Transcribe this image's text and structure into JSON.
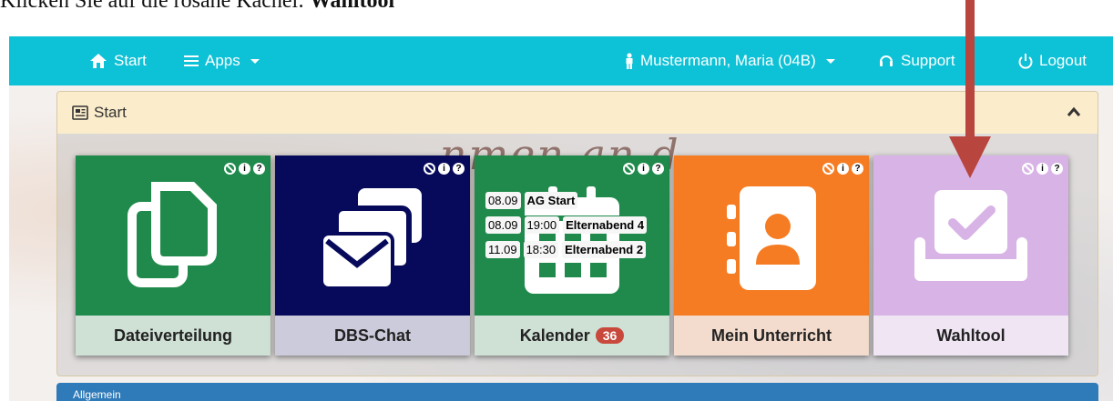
{
  "instruction": {
    "prefix": "Klicken Sie auf die rosane Kachel: ",
    "target": "Wahltool"
  },
  "navbar": {
    "background": "#0dc1d6",
    "start_label": "Start",
    "apps_label": "Apps",
    "user_label": "Mustermann, Maria (04B)",
    "support_label": "Support",
    "logout_label": "Logout"
  },
  "panel": {
    "title": "Start",
    "header_background": "#fbeccb",
    "background_text": "...nmen an d..."
  },
  "tiles": [
    {
      "label": "Dateiverteilung",
      "color": "#1f8a4c",
      "label_bg": "#cfe0d5",
      "icon": "files-icon"
    },
    {
      "label": "DBS-Chat",
      "color": "#070a5a",
      "label_bg": "#cccbdb",
      "icon": "messages-icon"
    },
    {
      "label": "Kalender",
      "color": "#1f8a4c",
      "label_bg": "#cfe0d5",
      "icon": "calendar-icon",
      "badge": "36",
      "events": [
        {
          "date": "08.09",
          "time": "",
          "title": "AG Start"
        },
        {
          "date": "08.09",
          "time": "19:00",
          "title": "Elternabend 4"
        },
        {
          "date": "11.09",
          "time": "18:30",
          "title": "Elternabend 2"
        }
      ]
    },
    {
      "label": "Mein Unterricht",
      "color": "#f57c22",
      "label_bg": "#f3dccd",
      "icon": "contacts-icon"
    },
    {
      "label": "Wahltool",
      "color": "#d8b3e6",
      "label_bg": "#efe5f3",
      "icon": "ballot-box-icon"
    }
  ],
  "tile_action_icons": [
    "ban-icon",
    "info-icon",
    "help-icon"
  ],
  "bottom_panel": {
    "title": "Allgemein",
    "color": "#2f7ab8"
  },
  "arrow_color": "#b8453e"
}
